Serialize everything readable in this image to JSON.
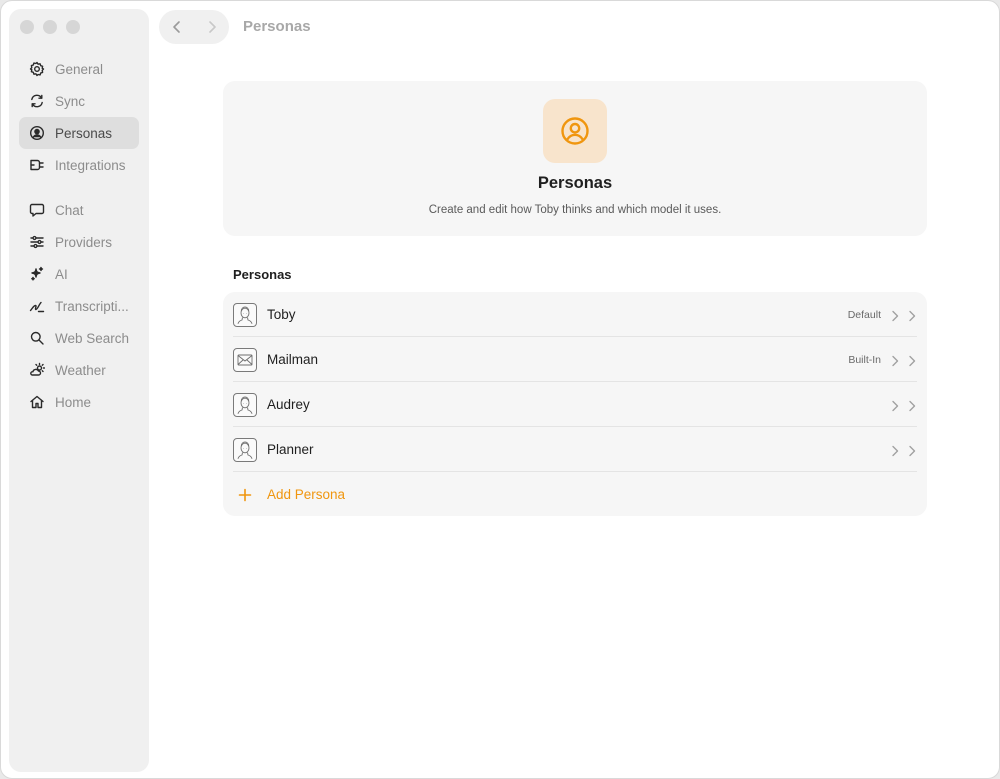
{
  "window": {
    "title": "Personas"
  },
  "sidebar": {
    "group1": [
      {
        "id": "general",
        "label": "General",
        "icon": "gear-icon"
      },
      {
        "id": "sync",
        "label": "Sync",
        "icon": "sync-icon"
      },
      {
        "id": "personas",
        "label": "Personas",
        "icon": "person-circle-icon",
        "active": true
      },
      {
        "id": "integrations",
        "label": "Integrations",
        "icon": "plug-icon"
      }
    ],
    "group2": [
      {
        "id": "chat",
        "label": "Chat",
        "icon": "chat-bubble-icon"
      },
      {
        "id": "providers",
        "label": "Providers",
        "icon": "sliders-icon"
      },
      {
        "id": "ai",
        "label": "AI",
        "icon": "sparkles-icon"
      },
      {
        "id": "transcription",
        "label": "Transcripti...",
        "icon": "signature-icon"
      },
      {
        "id": "web-search",
        "label": "Web Search",
        "icon": "search-icon"
      },
      {
        "id": "weather",
        "label": "Weather",
        "icon": "weather-icon"
      },
      {
        "id": "home",
        "label": "Home",
        "icon": "house-icon"
      }
    ]
  },
  "hero": {
    "icon": "person-circle-icon",
    "title": "Personas",
    "subtitle": "Create and edit how Toby thinks and which model it uses."
  },
  "personas": {
    "section_label": "Personas",
    "items": [
      {
        "name": "Toby",
        "badge": "Default",
        "icon": "portrait-icon"
      },
      {
        "name": "Mailman",
        "badge": "Built-In",
        "icon": "envelope-icon"
      },
      {
        "name": "Audrey",
        "badge": "",
        "icon": "portrait-icon"
      },
      {
        "name": "Planner",
        "badge": "",
        "icon": "portrait-icon"
      }
    ],
    "add_label": "Add Persona"
  },
  "colors": {
    "accent": "#f0960f",
    "hero_icon_bg": "#f8e4cc",
    "sidebar_bg": "#f0f0f0",
    "card_bg": "#f6f6f6"
  }
}
